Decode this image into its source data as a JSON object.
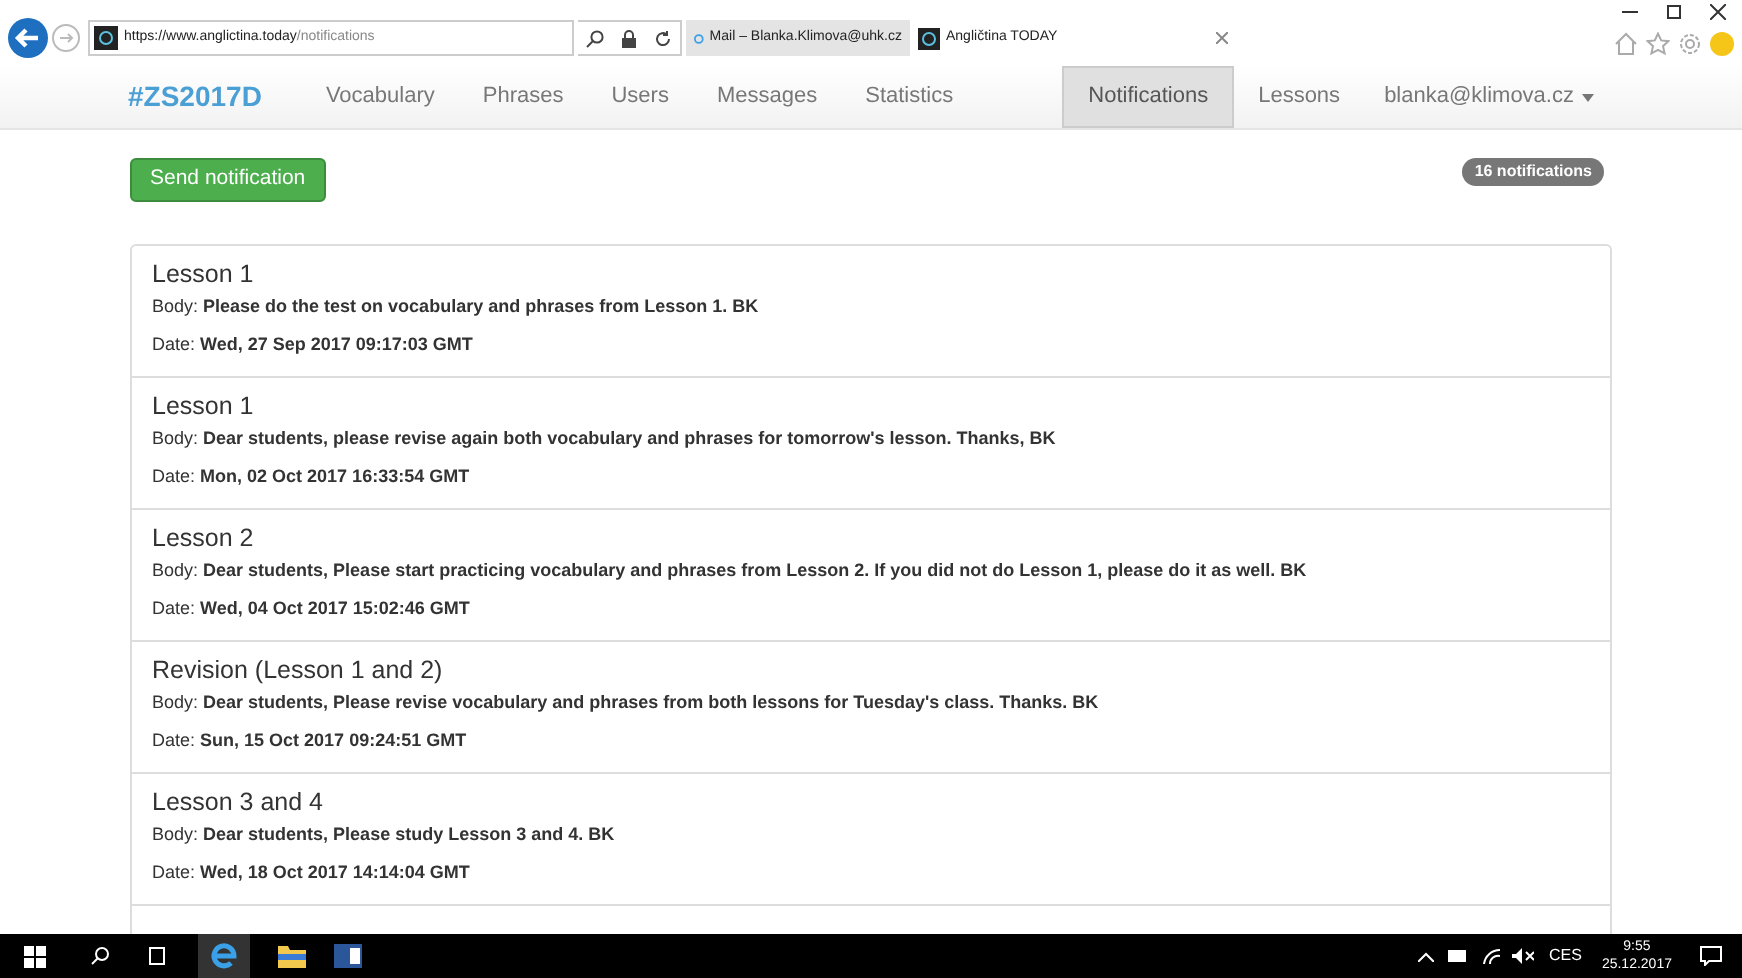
{
  "browser": {
    "url_host": "https://www.anglictina.today",
    "url_path": "/notifications",
    "tabs": [
      {
        "title": "Mail – Blanka.Klimova@uhk.cz",
        "selected": false,
        "kind": "mail"
      },
      {
        "title": "Angličtina TODAY",
        "selected": true,
        "kind": "site"
      }
    ]
  },
  "navbar": {
    "brand": "#ZS2017D",
    "left_items": [
      {
        "label": "Vocabulary",
        "selected": false
      },
      {
        "label": "Phrases",
        "selected": false
      },
      {
        "label": "Users",
        "selected": false
      },
      {
        "label": "Messages",
        "selected": false
      },
      {
        "label": "Statistics",
        "selected": false
      }
    ],
    "right_items": [
      {
        "label": "Notifications",
        "selected": true
      },
      {
        "label": "Lessons",
        "selected": false
      }
    ],
    "user": "blanka@klimova.cz"
  },
  "send_button": "Send notification",
  "count_badge": "16 notifications",
  "notifications": [
    {
      "title": "Lesson 1",
      "body_label": "Body:",
      "body": "Please do the test on vocabulary and phrases from Lesson 1. BK",
      "date_label": "Date:",
      "date": "Wed, 27 Sep 2017 09:17:03 GMT"
    },
    {
      "title": "Lesson 1",
      "body_label": "Body:",
      "body": "Dear students, please revise again both vocabulary and phrases for tomorrow's lesson. Thanks, BK",
      "date_label": "Date:",
      "date": "Mon, 02 Oct 2017 16:33:54 GMT"
    },
    {
      "title": "Lesson 2",
      "body_label": "Body:",
      "body": "Dear students, Please start practicing vocabulary and phrases from Lesson 2. If you did not do Lesson 1, please do it as well. BK",
      "date_label": "Date:",
      "date": "Wed, 04 Oct 2017 15:02:46 GMT"
    },
    {
      "title": "Revision (Lesson 1 and 2)",
      "body_label": "Body:",
      "body": "Dear students, Please revise vocabulary and phrases from both lessons for Tuesday's class. Thanks. BK",
      "date_label": "Date:",
      "date": "Sun, 15 Oct 2017 09:24:51 GMT"
    },
    {
      "title": "Lesson 3 and 4",
      "body_label": "Body:",
      "body": "Dear students, Please study Lesson 3 and 4. BK",
      "date_label": "Date:",
      "date": "Wed, 18 Oct 2017 14:14:04 GMT"
    }
  ],
  "taskbar": {
    "language": "CES",
    "time": "9:55",
    "date": "25.12.2017"
  }
}
